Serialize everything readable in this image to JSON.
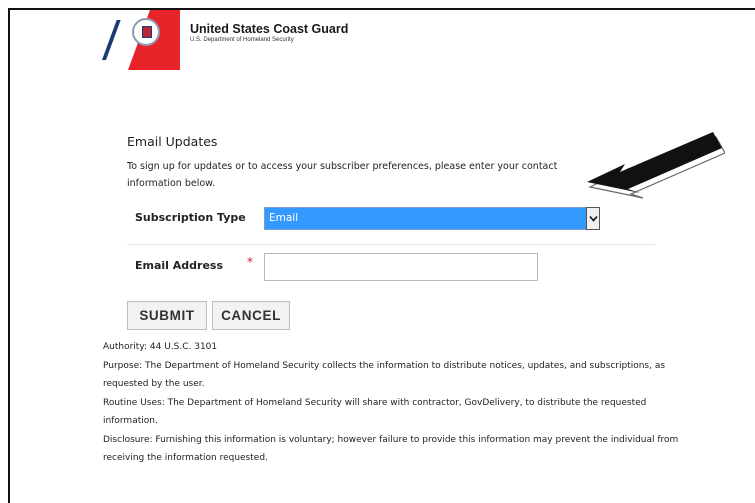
{
  "header": {
    "org_name": "United States Coast Guard",
    "org_sub": "U.S. Department of Homeland Security",
    "brand_colors": {
      "blue": "#1a3a73",
      "red": "#e8242b"
    }
  },
  "form": {
    "title": "Email Updates",
    "intro": "To sign up for updates or to access your subscriber preferences, please enter your contact information below.",
    "subscription_label": "Subscription Type",
    "subscription_value": "Email",
    "email_label": "Email Address",
    "required_marker": "*",
    "email_value": "",
    "submit_label": "SUBMIT",
    "cancel_label": "CANCEL"
  },
  "footer": {
    "lines": [
      "Authority: 44 U.S.C. 3101",
      "Purpose: The Department of Homeland Security collects the information to distribute notices, updates, and subscriptions, as requested by the user.",
      "Routine Uses: The Department of Homeland Security will share with contractor, GovDelivery, to distribute the requested information.",
      "Disclosure: Furnishing this information is voluntary; however failure to provide this information may prevent the individual from receiving the information requested."
    ]
  },
  "icons": {
    "logo": "coast-guard-logo",
    "dropdown": "chevron-down-icon",
    "annotation": "pointer-arrow-icon"
  }
}
